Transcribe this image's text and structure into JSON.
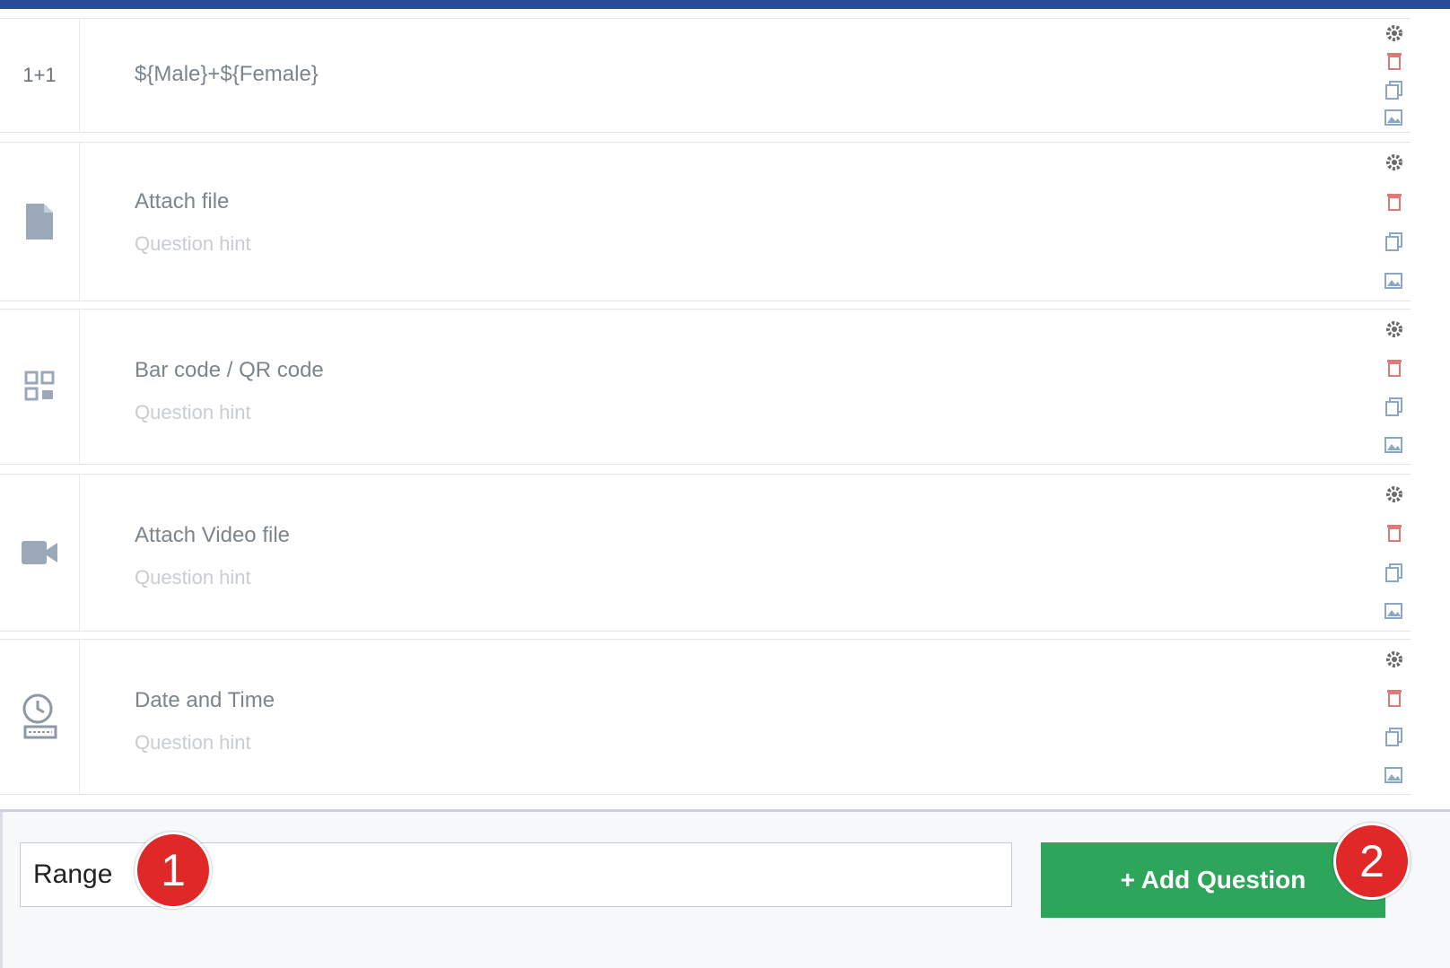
{
  "rows": [
    {
      "icon": "calculation-icon",
      "icon_text": "1+1",
      "title": "${Male}+${Female}",
      "hint": ""
    },
    {
      "icon": "file-icon",
      "title": "Attach file",
      "hint": "Question hint"
    },
    {
      "icon": "qr-code-icon",
      "title": "Bar code / QR code",
      "hint": "Question hint"
    },
    {
      "icon": "video-icon",
      "title": "Attach Video file",
      "hint": "Question hint"
    },
    {
      "icon": "datetime-icon",
      "title": "Date and Time",
      "hint": "Question hint"
    }
  ],
  "row_actions": [
    "settings-icon",
    "delete-icon",
    "duplicate-icon",
    "add-image-icon"
  ],
  "new_question": {
    "value": "Range",
    "button_label": "+ Add Question"
  },
  "callouts": {
    "one": "1",
    "two": "2"
  },
  "colors": {
    "topbar": "#2a4a9a",
    "button": "#2da55a",
    "badge": "#e02828",
    "delete": "#e07878",
    "icon_blue": "#8aa7c8"
  }
}
